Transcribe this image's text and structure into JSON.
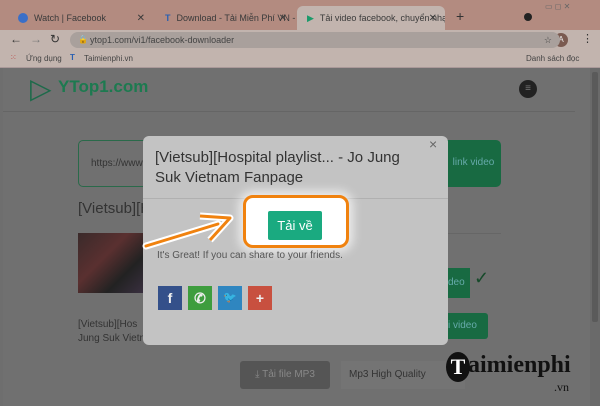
{
  "browser": {
    "tabs": [
      {
        "label": "Watch | Facebook",
        "icon": "facebook-icon"
      },
      {
        "label": "Download - Tải Miễn Phí VN - Pi",
        "icon": "taimienphi-icon"
      },
      {
        "label": "Tải video facebook, chuyển nhạc",
        "icon": "ytop1-icon"
      }
    ],
    "new_tab": "+",
    "url": "ytop1.com/vi1/facebook-downloader",
    "avatar": "A",
    "bookmarks": [
      {
        "label": "Ứng dụng"
      },
      {
        "label": "Taimienphi.vn"
      }
    ],
    "reading_list": "Danh sách đọc"
  },
  "site": {
    "logo": "YTop1.com",
    "url_input": "https://www",
    "get_button": "link video",
    "video_title_partial": "[Vietsub][H",
    "caption_line1": "[Vietsub][Hos",
    "caption_line2": "Jung Suk Vietn",
    "row1_button": "deo",
    "row1_check": "✓",
    "row2_button": "i video",
    "mp3_button": "Tải file MP3",
    "mp3_quality": "Mp3 High Quality"
  },
  "modal": {
    "title": "[Vietsub][Hospital playlist... - Jo Jung Suk Vietnam Fanpage",
    "close": "×",
    "download_button": "Tải về",
    "share_text": "It's Great! If you can share to your friends.",
    "share": [
      {
        "icon": "facebook-icon",
        "glyph": "f",
        "color": "#34508a"
      },
      {
        "icon": "whatsapp-icon",
        "glyph": "✆",
        "color": "#3e9d3e"
      },
      {
        "icon": "twitter-icon",
        "glyph": "🐦",
        "color": "#2f86c0"
      },
      {
        "icon": "plus-icon",
        "glyph": "+",
        "color": "#c8503f"
      }
    ]
  },
  "watermark": {
    "text": "aimienphi",
    "suffix": ".vn"
  }
}
